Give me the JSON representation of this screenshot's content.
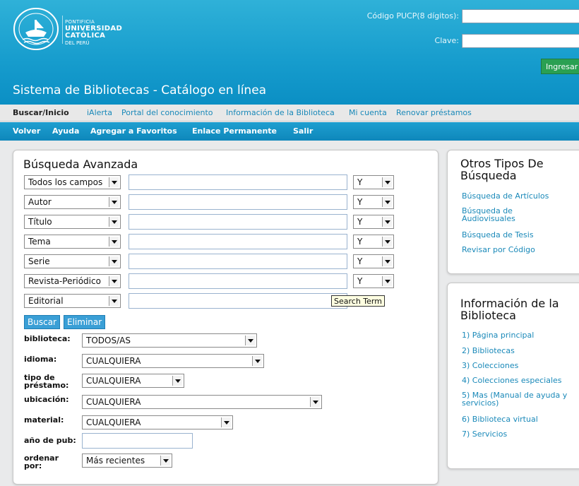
{
  "header": {
    "logo": {
      "line1": "PONTIFICIA",
      "line2": "UNIVERSIDAD",
      "line3": "CATÓLICA",
      "line4": "DEL PERÚ",
      "seal_text": "ET LUX IN TENEBRIS LUCET"
    },
    "login": {
      "code_label": "Código PUCP(8 dígitos):",
      "password_label": "Clave:",
      "submit_label": "Ingresar"
    },
    "site_title": "Sistema de Bibliotecas - Catálogo en línea"
  },
  "nav_primary": [
    "Buscar/Inicio",
    "iAlerta",
    "Portal del conocimiento",
    "Información de la Biblioteca",
    "Mi cuenta",
    "Renovar préstamos"
  ],
  "nav_secondary": [
    "Volver",
    "Ayuda",
    "Agregar a Favoritos",
    "Enlace Permanente",
    "Salir"
  ],
  "search": {
    "title": "Búsqueda Avanzada",
    "rows": [
      {
        "field": "Todos los campos",
        "bool": "Y"
      },
      {
        "field": "Autor",
        "bool": "Y"
      },
      {
        "field": "Título",
        "bool": "Y"
      },
      {
        "field": "Tema",
        "bool": "Y"
      },
      {
        "field": "Serie",
        "bool": "Y"
      },
      {
        "field": "Revista-Periódico",
        "bool": "Y"
      },
      {
        "field": "Editorial",
        "bool": ""
      }
    ],
    "tooltip": "Search Term",
    "buttons": {
      "search": "Buscar",
      "clear": "Eliminar"
    },
    "filters": {
      "library": {
        "label": "biblioteca:",
        "value": "TODOS/AS"
      },
      "language": {
        "label": "idioma:",
        "value": "CUALQUIERA"
      },
      "loan_type": {
        "label1": "tipo de",
        "label2": "préstamo:",
        "value": "CUALQUIERA"
      },
      "location": {
        "label": "ubicación:",
        "value": "CUALQUIERA"
      },
      "material": {
        "label": "material:",
        "value": "CUALQUIERA"
      },
      "year": {
        "label": "año de pub:",
        "value": ""
      },
      "sort": {
        "label1": "ordenar",
        "label2": "por:",
        "value": "Más recientes"
      }
    }
  },
  "other_search": {
    "title1": "Otros Tipos De",
    "title2": "Búsqueda",
    "links": [
      "Búsqueda de Artículos",
      "Búsqueda de",
      "Audiovisuales",
      "Búsqueda de Tesis",
      "Revisar por Código"
    ]
  },
  "library_info": {
    "title1": "Información de la",
    "title2": "Biblioteca",
    "links": [
      "1) Página principal",
      "2) Bibliotecas",
      "3) Colecciones",
      "4) Colecciones especiales",
      "5) Mas (Manual de ayuda y",
      "servicios)",
      "6) Biblioteca virtual",
      "7) Servicios"
    ]
  }
}
